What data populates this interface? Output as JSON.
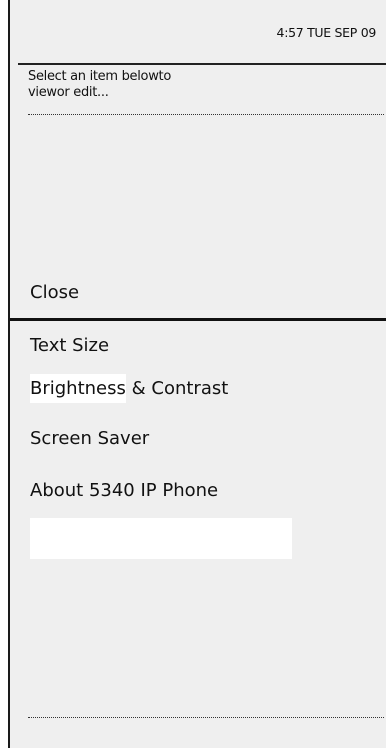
{
  "status_bar": {
    "clock": "4:57 TUE SEP 09"
  },
  "prompt": {
    "line1": "Select an item belowto",
    "line2": "viewor edit..."
  },
  "close_label": "Close",
  "menu": {
    "items": [
      {
        "label": "Text Size"
      },
      {
        "label_highlight": "Brightness",
        "label_rest": " & Contrast"
      },
      {
        "label": "Screen Saver"
      },
      {
        "label": "About 5340 IP Phone"
      }
    ]
  }
}
